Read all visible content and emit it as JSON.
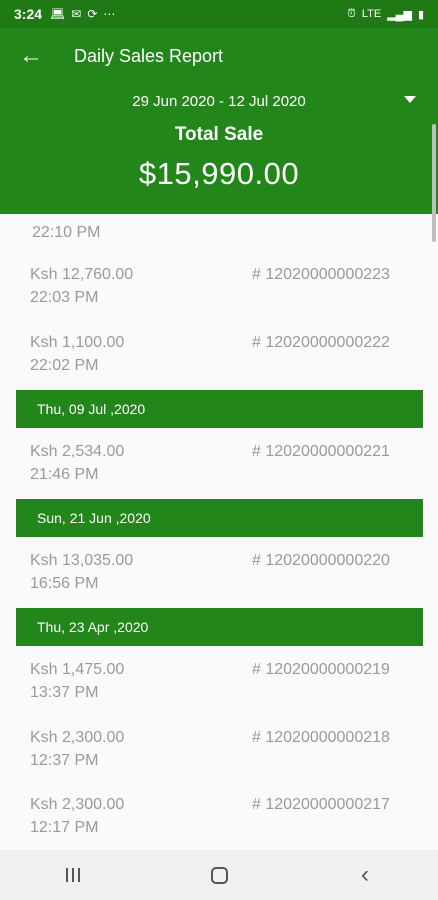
{
  "status_bar": {
    "time": "3:24",
    "icons": [
      "laptop-icon",
      "mail-icon",
      "sync-icon",
      "more-icon"
    ],
    "right_icons": [
      "alarm-icon",
      "lte-icon",
      "signal-icon",
      "battery-icon"
    ],
    "lte": "LTE"
  },
  "header": {
    "title": "Daily Sales Report",
    "date_range": "29 Jun 2020 - 12 Jul 2020",
    "total_label": "Total Sale",
    "total_amount": "$15,990.00"
  },
  "list": {
    "partial_time": "22:10 PM",
    "sales": [
      {
        "amount": "Ksh 12,760.00",
        "time": "22:03 PM",
        "receipt": "# 12020000000223"
      },
      {
        "amount": "Ksh 1,100.00",
        "time": "22:02 PM",
        "receipt": "# 12020000000222"
      },
      {
        "amount": "Ksh 2,534.00",
        "time": "21:46 PM",
        "receipt": "# 12020000000221"
      },
      {
        "amount": "Ksh 13,035.00",
        "time": "16:56 PM",
        "receipt": "# 12020000000220"
      },
      {
        "amount": "Ksh 1,475.00",
        "time": "13:37 PM",
        "receipt": "# 12020000000219"
      },
      {
        "amount": "Ksh 2,300.00",
        "time": "12:37 PM",
        "receipt": "# 12020000000218"
      },
      {
        "amount": "Ksh 2,300.00",
        "time": "12:17 PM",
        "receipt": "# 12020000000217"
      }
    ],
    "day_headers": [
      "Thu, 09 Jul ,2020",
      "Sun, 21 Jun ,2020",
      "Thu, 23 Apr ,2020"
    ]
  },
  "colors": {
    "primary": "#22861a",
    "status_bar": "#1f7a16",
    "row_text": "#9a9a9a"
  }
}
